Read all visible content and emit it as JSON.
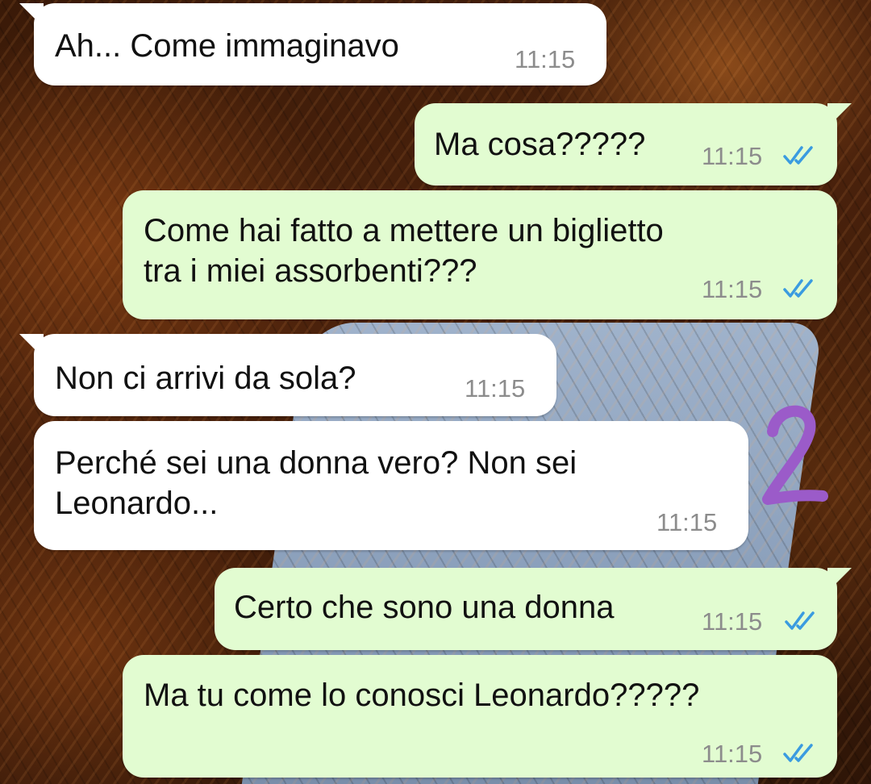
{
  "conversation": {
    "messages": [
      {
        "direction": "incoming",
        "text": "Ah... Come immaginavo",
        "time": "11:15"
      },
      {
        "direction": "outgoing",
        "text": "Ma cosa?????",
        "time": "11:15",
        "status": "read-double-check-icon"
      },
      {
        "direction": "outgoing",
        "text": "Come hai fatto a mettere un biglietto\ntra i miei assorbenti???",
        "time": "11:15",
        "status": "read-double-check-icon"
      },
      {
        "direction": "incoming",
        "text": "Non ci arrivi da sola?",
        "time": "11:15"
      },
      {
        "direction": "incoming",
        "text": "Perché sei una donna vero? Non sei\nLeonardo...",
        "time": "11:15"
      },
      {
        "direction": "outgoing",
        "text": "Certo che sono una donna",
        "time": "11:15",
        "status": "read-double-check-icon"
      },
      {
        "direction": "outgoing",
        "text": "Ma tu come lo conosci Leonardo?????",
        "time": "11:15",
        "status": "read-double-check-icon"
      }
    ]
  },
  "annotation": {
    "label": "2",
    "color": "#9b5bc9"
  },
  "colors": {
    "incoming_bubble": "#ffffff",
    "outgoing_bubble": "#e2fcd1",
    "timestamp": "#8c8c8c",
    "read_ticks": "#3a9be0"
  }
}
